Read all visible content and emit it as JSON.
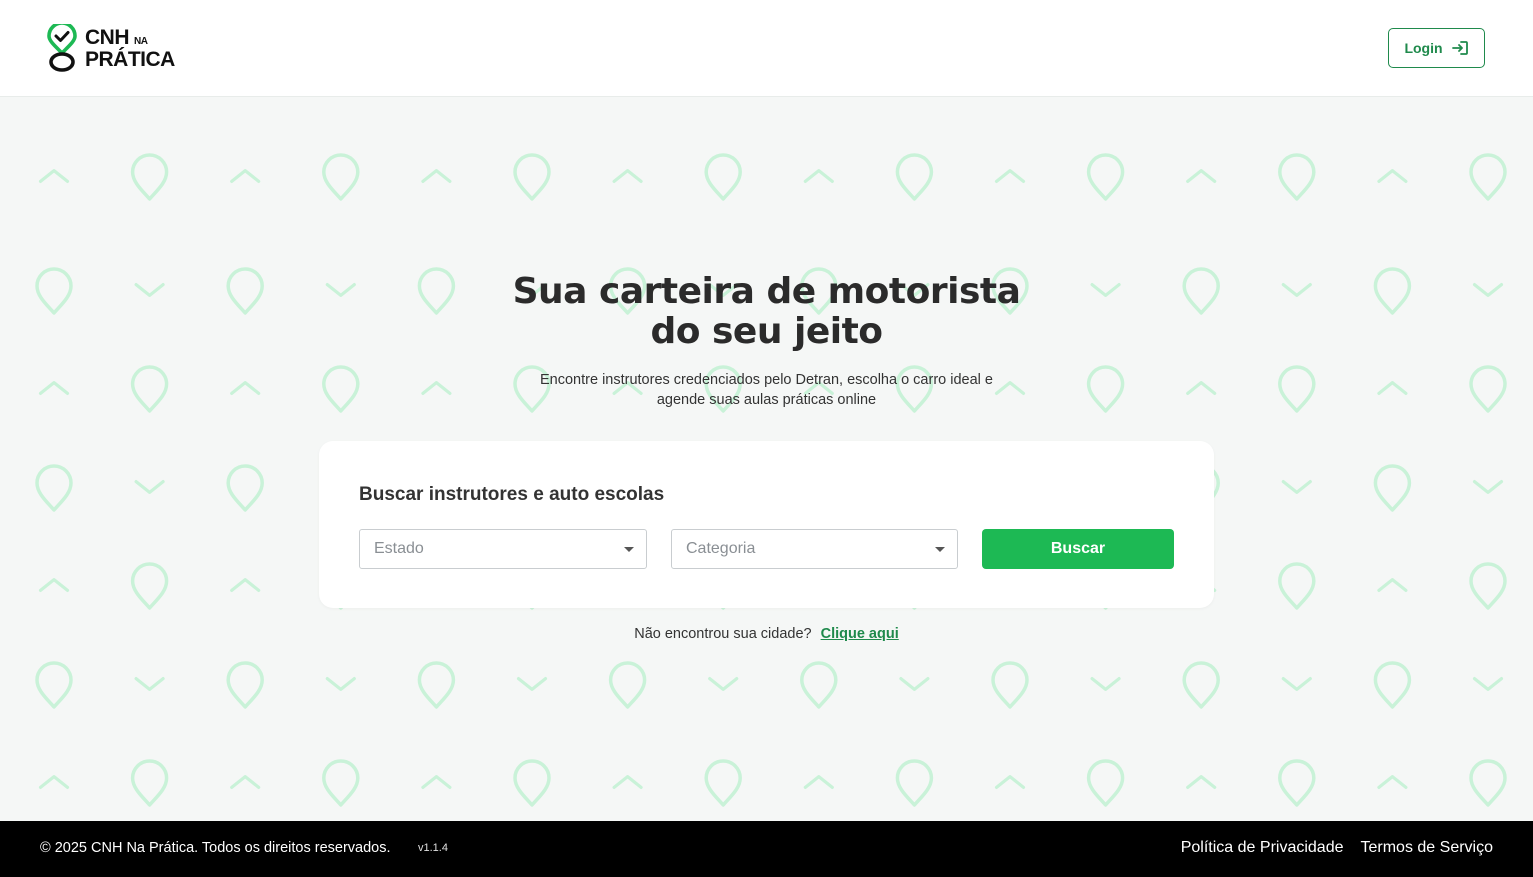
{
  "header": {
    "logo_line1": "CNH",
    "logo_na": "NA",
    "logo_line2": "PRÁTICA",
    "login_label": "Login"
  },
  "hero": {
    "title_line1": "Sua carteira de motorista",
    "title_line2": "do seu jeito",
    "subtitle_line1": "Encontre instrutores credenciados pelo Detran, escolha o carro ideal e",
    "subtitle_line2": "agende suas aulas práticas online"
  },
  "search": {
    "title": "Buscar instrutores e auto escolas",
    "estado_placeholder": "Estado",
    "categoria_placeholder": "Categoria",
    "button_label": "Buscar"
  },
  "not_found": {
    "text": "Não encontrou sua cidade?",
    "link": "Clique aqui"
  },
  "footer": {
    "copyright": "© 2025 CNH Na Prática. Todos os direitos reservados.",
    "version": "v1.1.4",
    "privacy": "Política de Privacidade",
    "terms": "Termos de Serviço"
  },
  "colors": {
    "brand_green": "#1db954",
    "dark_green": "#1f8a4c",
    "pattern_green": "#c9f2d8",
    "footer_bg": "#000000"
  },
  "icons": {
    "logo": "map-pin-check-icon",
    "login": "sign-in-icon",
    "dropdown": "caret-down-icon"
  }
}
